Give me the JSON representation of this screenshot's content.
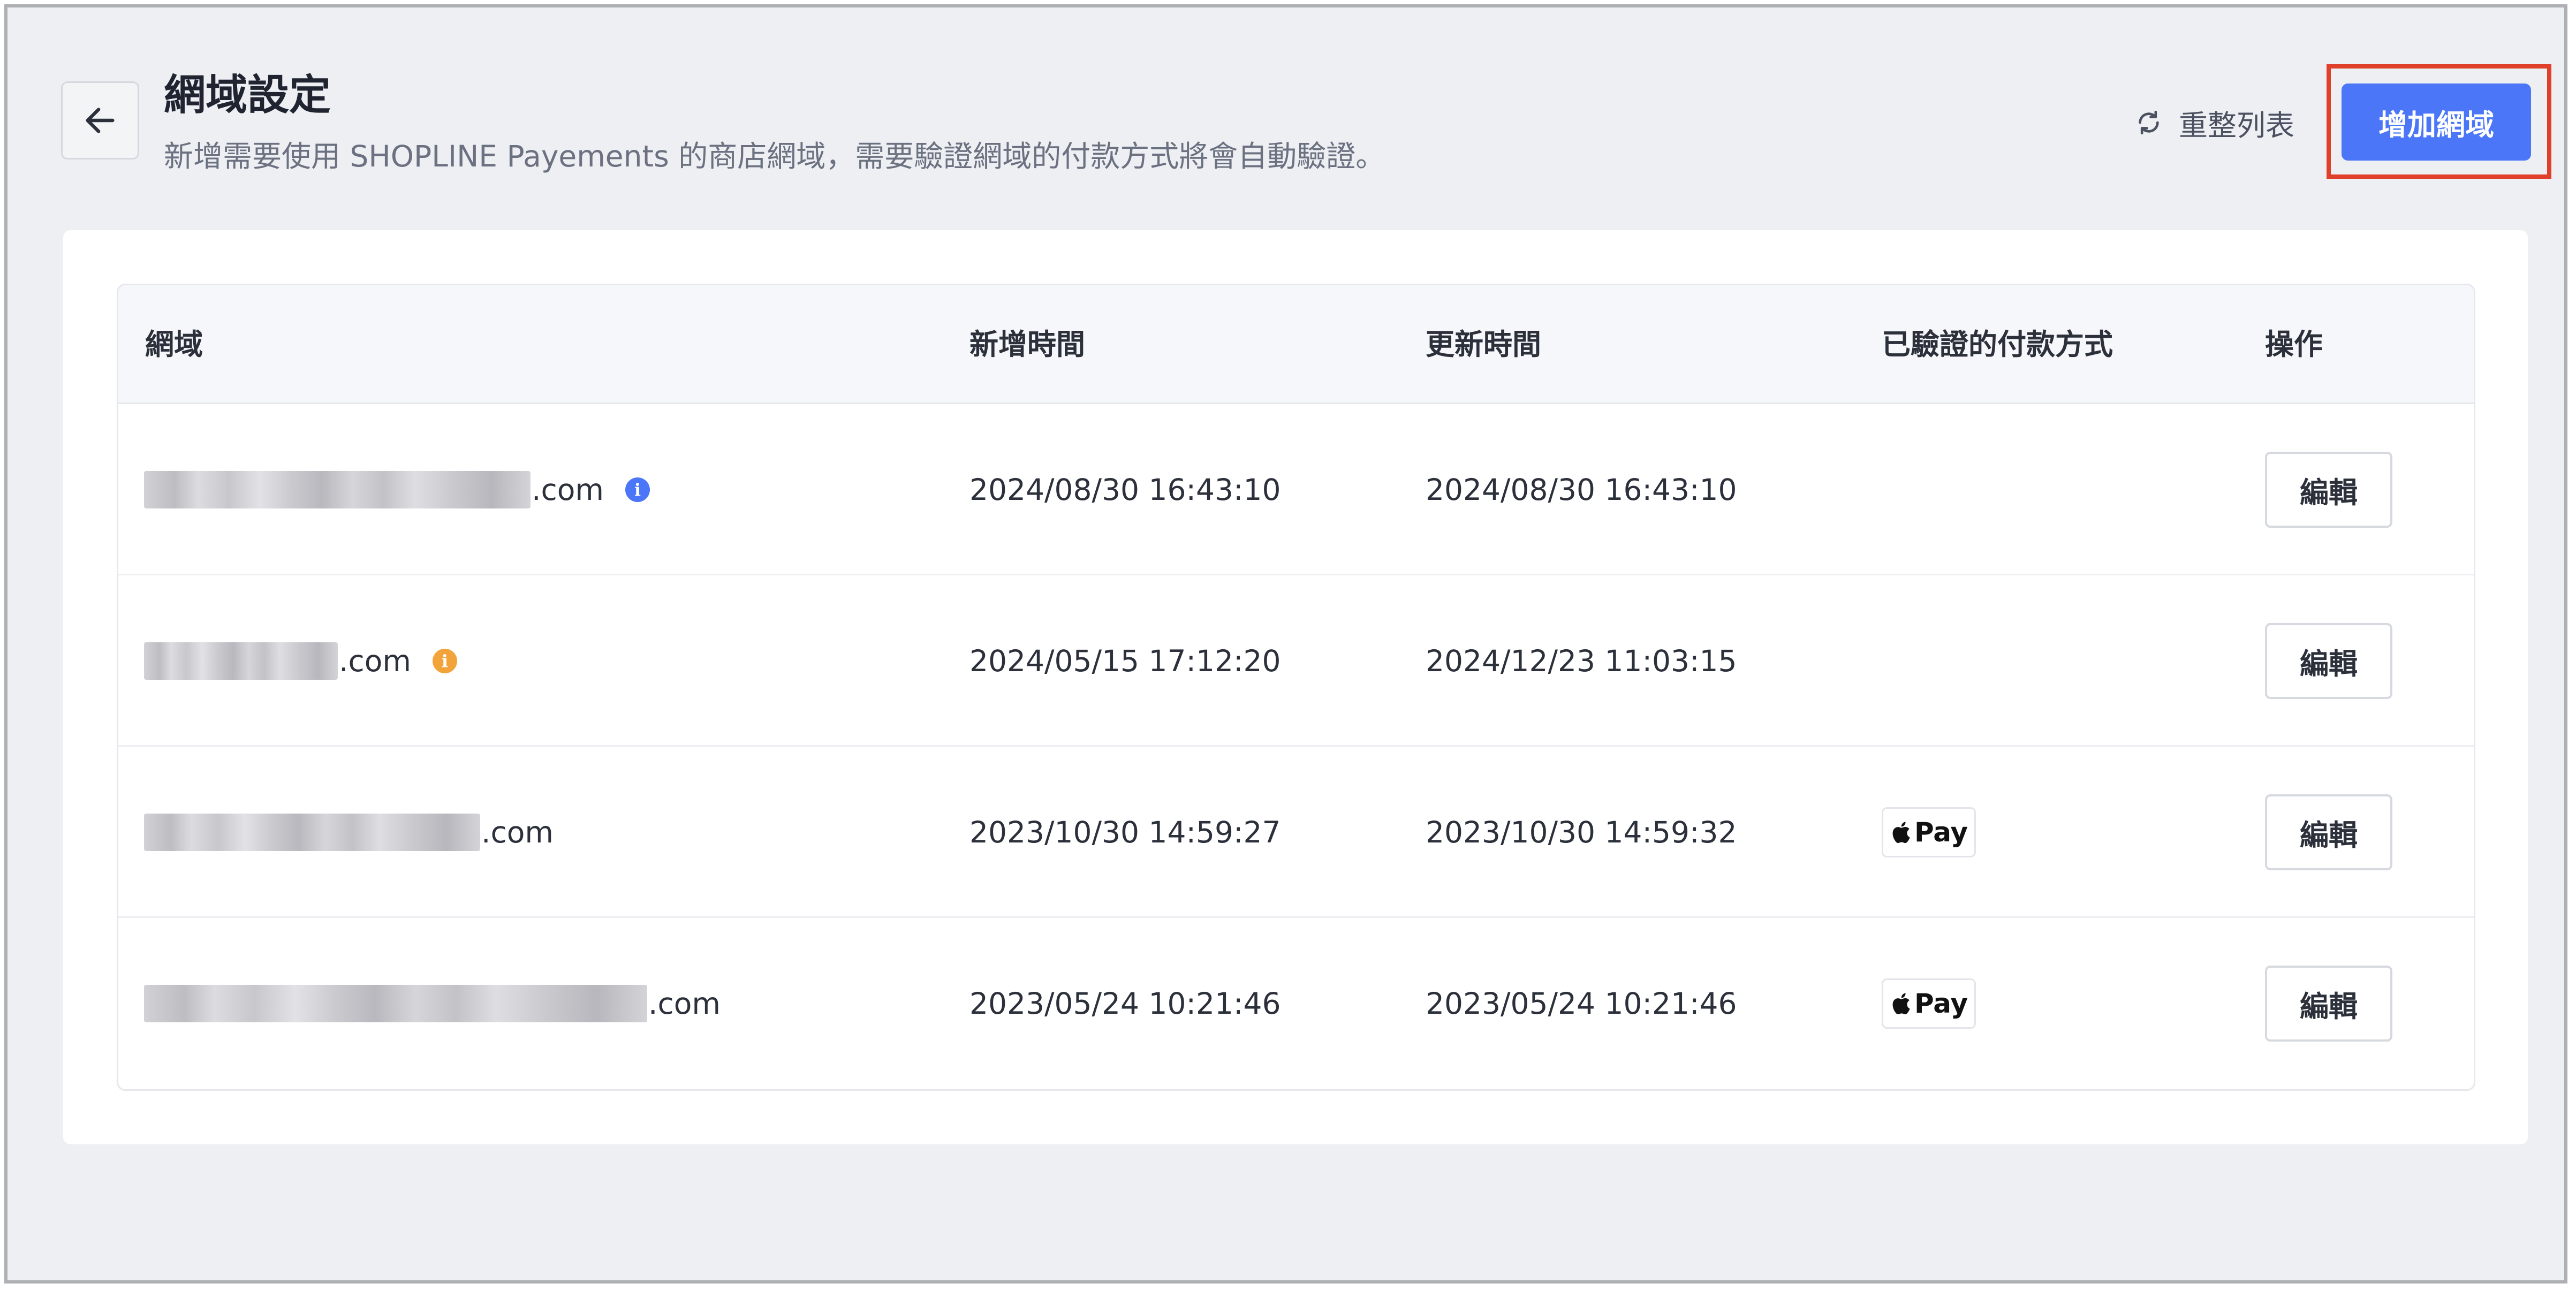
{
  "header": {
    "back_icon": "arrow-left-icon",
    "title": "網域設定",
    "subtitle": "新增需要使用 SHOPLINE Payements 的商店網域，需要驗證網域的付款方式將會自動驗證。",
    "reload_icon": "refresh-icon",
    "reload_label": "重整列表",
    "add_label": "增加網域",
    "add_button_color": "#4a76f7",
    "highlight_color": "#e0402a"
  },
  "table": {
    "columns": [
      "網域",
      "新增時間",
      "更新時間",
      "已驗證的付款方式",
      "操作"
    ],
    "rows": [
      {
        "domain_visible": ".com",
        "info_icon": "info-icon",
        "info_color": "#4a76f7",
        "created": "2024/08/30 16:43:10",
        "updated": "2024/08/30 16:43:10",
        "payment": "",
        "action": "編輯"
      },
      {
        "domain_visible": ".com",
        "info_icon": "info-icon",
        "info_color": "#f2a33a",
        "created": "2024/05/15 17:12:20",
        "updated": "2024/12/23 11:03:15",
        "payment": "",
        "action": "編輯"
      },
      {
        "domain_visible": ".com",
        "info_icon": "",
        "created": "2023/10/30 14:59:27",
        "updated": "2023/10/30 14:59:32",
        "payment": "Pay",
        "payment_icon": "apple-logo-icon",
        "action": "編輯"
      },
      {
        "domain_visible": ".com",
        "info_icon": "",
        "created": "2023/05/24 10:21:46",
        "updated": "2023/05/24 10:21:46",
        "payment": "Pay",
        "payment_icon": "apple-logo-icon",
        "action": "編輯"
      }
    ]
  }
}
